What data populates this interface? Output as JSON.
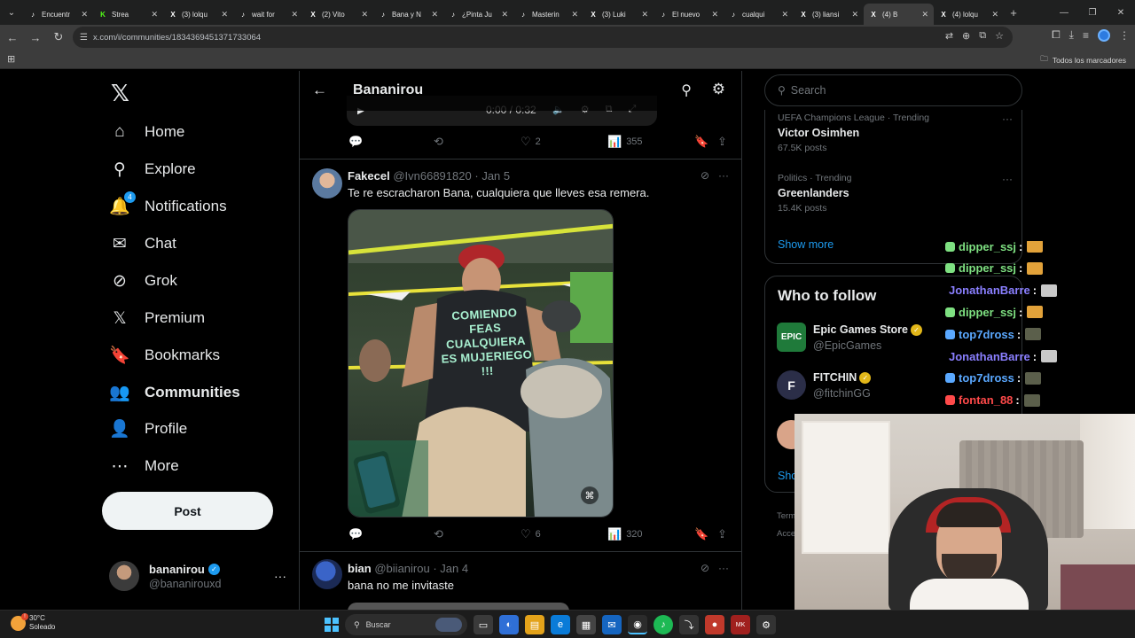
{
  "browser": {
    "tabs": [
      {
        "label": "Encuentr",
        "icon": "tiktok-icon",
        "active": false
      },
      {
        "label": "Strea",
        "icon": "kick-icon",
        "active": false
      },
      {
        "label": "(3) lolqu",
        "icon": "x-icon",
        "active": false
      },
      {
        "label": "wait for",
        "icon": "tiktok-icon",
        "active": false
      },
      {
        "label": "(2) Vito",
        "icon": "x-icon",
        "active": false
      },
      {
        "label": "Bana y N",
        "icon": "tiktok-icon",
        "active": false
      },
      {
        "label": "¿Pinta Ju",
        "icon": "tiktok-icon",
        "active": false
      },
      {
        "label": "Masterin",
        "icon": "tiktok-icon",
        "active": false
      },
      {
        "label": "(3) Luki",
        "icon": "x-icon",
        "active": false
      },
      {
        "label": "El nuevo",
        "icon": "tiktok-icon",
        "active": false
      },
      {
        "label": "cualqui",
        "icon": "tiktok-icon",
        "active": false
      },
      {
        "label": "(3) liansi",
        "icon": "x-icon",
        "active": false
      },
      {
        "label": "(4) B",
        "icon": "x-icon",
        "active": true
      },
      {
        "label": "(4) lolqu",
        "icon": "x-icon",
        "active": false
      }
    ],
    "url": "x.com/i/communities/1834369451371733064",
    "bookmarks_label": "Todos los marcadores"
  },
  "nav": {
    "items": [
      {
        "label": "Home",
        "icon": "home-icon",
        "glyph": "⌂",
        "bold": false
      },
      {
        "label": "Explore",
        "icon": "search-icon",
        "glyph": "⚲",
        "bold": false
      },
      {
        "label": "Notifications",
        "icon": "bell-icon",
        "glyph": "🔔",
        "bold": false,
        "badge": "4"
      },
      {
        "label": "Chat",
        "icon": "mail-icon",
        "glyph": "✉",
        "bold": false
      },
      {
        "label": "Grok",
        "icon": "grok-icon",
        "glyph": "⊘",
        "bold": false
      },
      {
        "label": "Premium",
        "icon": "x-premium-icon",
        "glyph": "𝕏",
        "bold": false
      },
      {
        "label": "Bookmarks",
        "icon": "bookmark-icon",
        "glyph": "🔖",
        "bold": false
      },
      {
        "label": "Communities",
        "icon": "communities-icon",
        "glyph": "👥",
        "bold": true
      },
      {
        "label": "Profile",
        "icon": "person-icon",
        "glyph": "👤",
        "bold": false
      },
      {
        "label": "More",
        "icon": "more-circle-icon",
        "glyph": "⋯",
        "bold": false
      }
    ],
    "post_label": "Post",
    "account": {
      "name": "bananirou",
      "handle": "@bananirouxd"
    }
  },
  "community": {
    "title": "Bananirou"
  },
  "video": {
    "time": "0:00 / 0:32"
  },
  "top_actions": {
    "likes": "2",
    "views": "355"
  },
  "tweets": [
    {
      "name": "Fakecel",
      "handle": "@Ivn66891820",
      "date": "Jan 5",
      "text": "Te re escracharon Bana, cualquiera que lleves esa remera.",
      "image_shirt_text": "COMIENDO FEAS CUALQUIERA ES MUJERIEGO !!!",
      "likes": "6",
      "views": "320"
    },
    {
      "name": "bian",
      "handle": "@biianirou",
      "date": "Jan 4",
      "text": "bana no me invitaste"
    }
  ],
  "right": {
    "search_placeholder": "Search",
    "trends": [
      {
        "meta": "UEFA Champions League · Trending",
        "title": "Victor Osimhen",
        "count": "67.5K posts"
      },
      {
        "meta": "Politics · Trending",
        "title": "Greenlanders",
        "count": "15.4K posts"
      }
    ],
    "show_more": "Show more",
    "who_to_follow_title": "Who to follow",
    "follow": [
      {
        "name": "Epic Games Store",
        "handle": "@EpicGames",
        "verified": "gold",
        "color": "#1f7a3a",
        "logo": "EPIC"
      },
      {
        "name": "FITCHIN",
        "handle": "@fitchinGG",
        "verified": "gold",
        "color": "#2b2e48",
        "logo": "F"
      }
    ],
    "show_partial": "Sho",
    "footer_1": "Term",
    "footer_2": "Acce"
  },
  "chat": [
    {
      "user": "dipper_ssj",
      "color": "#7ee081"
    },
    {
      "user": "dipper_ssj",
      "color": "#7ee081"
    },
    {
      "user": "JonathanBarre",
      "color": "#8a7fff"
    },
    {
      "user": "dipper_ssj",
      "color": "#7ee081"
    },
    {
      "user": "top7dross",
      "color": "#5aa8ff"
    },
    {
      "user": "JonathanBarre",
      "color": "#8a7fff"
    },
    {
      "user": "top7dross",
      "color": "#5aa8ff"
    },
    {
      "user": "fontan_88",
      "color": "#ff4a4a"
    }
  ],
  "taskbar": {
    "temp": "30°C",
    "condition": "Soleado",
    "search_label": "Buscar"
  }
}
